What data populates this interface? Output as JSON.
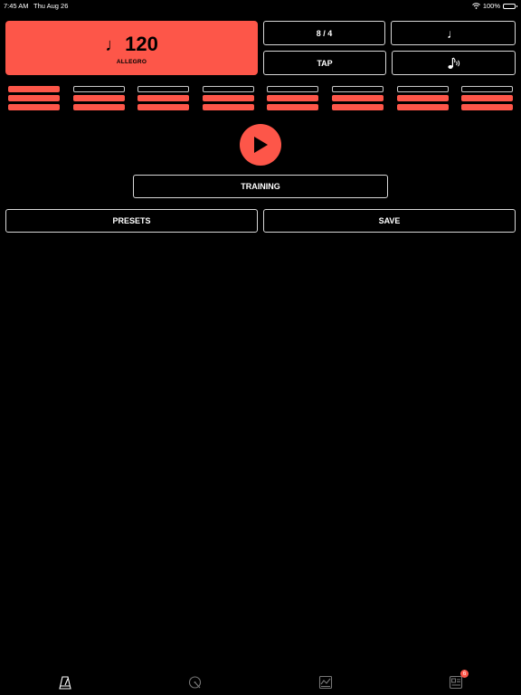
{
  "status_bar": {
    "time": "7:45 AM",
    "date": "Thu Aug 26",
    "battery": "100%"
  },
  "tempo": {
    "note_glyph": "♩",
    "bpm": "120",
    "marking": "ALLEGRO"
  },
  "controls": {
    "time_signature": "8 / 4",
    "subdivision_glyph": "♩",
    "tap_label": "TAP",
    "sound_glyph": "♪))"
  },
  "beats": {
    "count": 8,
    "levels_lit": [
      3,
      2,
      2,
      2,
      2,
      2,
      2,
      2
    ]
  },
  "actions": {
    "training_label": "TRAINING",
    "presets_label": "PRESETS",
    "save_label": "SAVE"
  },
  "tabbar": {
    "tabs": [
      {
        "icon": "metronome-icon"
      },
      {
        "icon": "tuner-icon"
      },
      {
        "icon": "practice-log-icon"
      },
      {
        "icon": "library-icon",
        "badge": "6"
      }
    ]
  },
  "colors": {
    "accent": "#fd5649",
    "background": "#000000",
    "outline": "#d8d8d8"
  }
}
